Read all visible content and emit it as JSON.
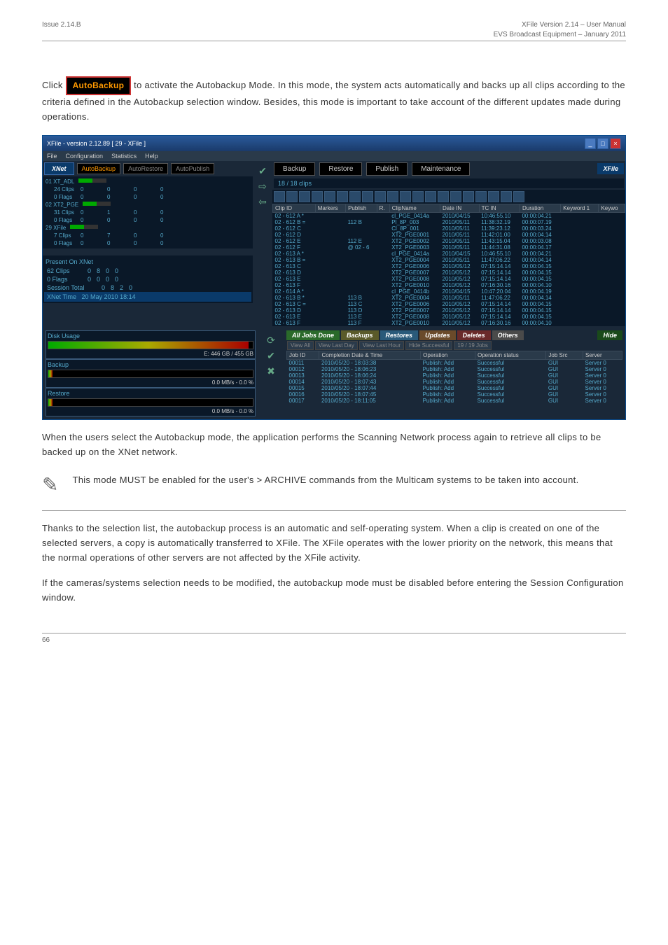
{
  "doc": {
    "issue": "Issue 2.14.B",
    "product": "XFile Version 2.14 – User Manual",
    "company": "EVS Broadcast Equipment – January 2011",
    "page": "66"
  },
  "text": {
    "click": "Click ",
    "autobackup_btn": "AutoBackup",
    "p1": " to activate the Autobackup Mode. In this mode, the system acts automatically and backs up all clips according to the criteria defined in the Autobackup selection window. Besides, this mode is important to take account of the different updates made during operations.",
    "p2": "When the users select the Autobackup mode, the application performs the Scanning Network process again to retrieve all clips to be backed up on the XNet network.",
    "note": "This mode MUST be enabled for the user's > ARCHIVE commands from the Multicam systems to be taken into account.",
    "p3": "Thanks to the selection list, the autobackup process is an automatic and self-operating system. When a clip is created on one of the selected servers, a copy is automatically transferred to XFile. The XFile operates with the lower priority on the network, this means that the normal operations of other servers are not affected by the XFile activity.",
    "p4": "If the cameras/systems selection needs to be modified, the autobackup mode must be disabled before entering the Session Configuration window."
  },
  "app": {
    "title": "XFile - version 2.12.89 [ 29 - XFile ]",
    "menus": [
      "File",
      "Configuration",
      "Statistics",
      "Help"
    ],
    "xnet": "XNet",
    "mode_btns": [
      "AutoBackup",
      "AutoRestore",
      "AutoPublish"
    ],
    "xfile": "XFile",
    "right_btns": [
      "Backup",
      "Restore",
      "Publish",
      "Maintenance"
    ],
    "servers": [
      {
        "hdr": "01 XT_ADL",
        "rows": [
          {
            "l": "24 Clips",
            "a": "0",
            "b": "0",
            "c": "0",
            "d": "0"
          },
          {
            "l": "0 Flags",
            "a": "0",
            "b": "0",
            "c": "0",
            "d": "0"
          }
        ]
      },
      {
        "hdr": "02 XT2_PGE",
        "rows": [
          {
            "l": "31 Clips",
            "a": "0",
            "b": "1",
            "c": "0",
            "d": "0"
          },
          {
            "l": "0 Flags",
            "a": "0",
            "b": "0",
            "c": "0",
            "d": "0"
          }
        ]
      },
      {
        "hdr": "29 XFile",
        "rows": [
          {
            "l": "7 Clips",
            "a": "0",
            "b": "7",
            "c": "0",
            "d": "0"
          },
          {
            "l": "0 Flags",
            "a": "0",
            "b": "0",
            "c": "0",
            "d": "0"
          }
        ]
      }
    ],
    "present": {
      "title": "Present On XNet",
      "rows": [
        {
          "l": "62 Clips",
          "a": "0",
          "b": "8",
          "c": "0",
          "d": "0"
        },
        {
          "l": "0 Flags",
          "a": "0",
          "b": "0",
          "c": "0",
          "d": "0"
        }
      ],
      "session": {
        "l": "Session Total",
        "a": "0",
        "b": "8",
        "c": "2",
        "d": "0"
      },
      "time_label": "XNet Time",
      "time": "20 May 2010   18:14"
    },
    "clip_count": "18 / 18 clips",
    "clips": {
      "cols": [
        "Clip ID",
        "Markers",
        "Publish",
        "R.",
        "ClipName",
        "Date IN",
        "TC IN",
        "Duration",
        "Keyword 1",
        "Keywo"
      ],
      "rows": [
        {
          "id": "02 - 612 A *",
          "pub": "",
          "name": "cl_PGE_0414a",
          "date": "2010/04/15",
          "tc": "10:46:55.10",
          "dur": "00:00:04.21"
        },
        {
          "id": "02 - 612 B =",
          "pub": "112 B",
          "name": "Pl_8P_003",
          "date": "2010/05/11",
          "tc": "11:38:32.19",
          "dur": "00:00:07.19"
        },
        {
          "id": "02 - 612 C",
          "pub": "",
          "name": "Cl_8P_001",
          "date": "2010/05/11",
          "tc": "11:39:23.12",
          "dur": "00:00:03.24"
        },
        {
          "id": "02 - 612 D",
          "pub": "",
          "name": "XT2_PGE0001",
          "date": "2010/05/11",
          "tc": "11:42:01.00",
          "dur": "00:00:04.14"
        },
        {
          "id": "02 - 612 E",
          "pub": "112 E",
          "name": "XT2_PGE0002",
          "date": "2010/05/11",
          "tc": "11:43:15.04",
          "dur": "00:00:03.08"
        },
        {
          "id": "02 - 612 F",
          "pub": "@ 02 - 6",
          "name": "XT2_PGE0003",
          "date": "2010/05/11",
          "tc": "11:44:31.08",
          "dur": "00:00:04.17"
        },
        {
          "id": "02 - 613 A *",
          "pub": "",
          "name": "cl_PGE_0414a",
          "date": "2010/04/15",
          "tc": "10:46:55.10",
          "dur": "00:00:04.21"
        },
        {
          "id": "02 - 613 B =",
          "pub": "",
          "name": "XT2_PGE0004",
          "date": "2010/05/11",
          "tc": "11:47:06.22",
          "dur": "00:00:04.14"
        },
        {
          "id": "02 - 613 C",
          "pub": "",
          "name": "XT2_PGE0006",
          "date": "2010/05/12",
          "tc": "07:15:14.14",
          "dur": "00:00:04.15"
        },
        {
          "id": "02 - 613 D",
          "pub": "",
          "name": "XT2_PGE0007",
          "date": "2010/05/12",
          "tc": "07:15:14.14",
          "dur": "00:00:04.15"
        },
        {
          "id": "02 - 613 E",
          "pub": "",
          "name": "XT2_PGE0008",
          "date": "2010/05/12",
          "tc": "07:15:14.14",
          "dur": "00:00:04.15"
        },
        {
          "id": "02 - 613 F",
          "pub": "",
          "name": "XT2_PGE0010",
          "date": "2010/05/12",
          "tc": "07:16:30.16",
          "dur": "00:00:04.10"
        },
        {
          "id": "02 - 614 A *",
          "pub": "",
          "name": "cl_PGE_0414b",
          "date": "2010/04/15",
          "tc": "10:47:20.04",
          "dur": "00:00:04.19"
        },
        {
          "id": "02 - 613 B *",
          "pub": "113 B",
          "name": "XT2_PGE0004",
          "date": "2010/05/11",
          "tc": "11:47:06.22",
          "dur": "00:00:04.14"
        },
        {
          "id": "02 - 613 C =",
          "pub": "113 C",
          "name": "XT2_PGE0006",
          "date": "2010/05/12",
          "tc": "07:15:14.14",
          "dur": "00:00:04.15"
        },
        {
          "id": "02 - 613 D",
          "pub": "113 D",
          "name": "XT2_PGE0007",
          "date": "2010/05/12",
          "tc": "07:15:14.14",
          "dur": "00:00:04.15"
        },
        {
          "id": "02 - 613 E",
          "pub": "113 E",
          "name": "XT2_PGE0008",
          "date": "2010/05/12",
          "tc": "07:15:14.14",
          "dur": "00:00:04.15"
        },
        {
          "id": "02 - 613 F",
          "pub": "113 F",
          "name": "XT2_PGE0010",
          "date": "2010/05/12",
          "tc": "07:16:30.16",
          "dur": "00:00:04.10"
        }
      ]
    },
    "disk": {
      "usage_label": "Disk Usage",
      "e_label": "E: 446 GB / 455 GB",
      "backup_label": "Backup",
      "backup_rate": "0.0 MB/s - 0.0 %",
      "restore_label": "Restore",
      "restore_rate": "0.0 MB/s - 0.0 %"
    },
    "jobs": {
      "tabs": [
        "All Jobs Done",
        "Backups",
        "Restores",
        "Updates",
        "Deletes",
        "Others"
      ],
      "hide": "Hide",
      "filters": [
        "View All",
        "View Last Day",
        "View Last Hour",
        "Hide Successful",
        "19 / 19 Jobs"
      ],
      "cols": [
        "Job ID",
        "Completion Date & Time",
        "Operation",
        "Operation status",
        "Job Src",
        "Server"
      ],
      "rows": [
        {
          "id": "00011",
          "dt": "2010/05/20 - 18:03:38",
          "op": "Publish: Add",
          "st": "Successful",
          "src": "GUI",
          "srv": "Server 0"
        },
        {
          "id": "00012",
          "dt": "2010/05/20 - 18:06:23",
          "op": "Publish: Add",
          "st": "Successful",
          "src": "GUI",
          "srv": "Server 0"
        },
        {
          "id": "00013",
          "dt": "2010/05/20 - 18:06:24",
          "op": "Publish: Add",
          "st": "Successful",
          "src": "GUI",
          "srv": "Server 0"
        },
        {
          "id": "00014",
          "dt": "2010/05/20 - 18:07:43",
          "op": "Publish: Add",
          "st": "Successful",
          "src": "GUI",
          "srv": "Server 0"
        },
        {
          "id": "00015",
          "dt": "2010/05/20 - 18:07:44",
          "op": "Publish: Add",
          "st": "Successful",
          "src": "GUI",
          "srv": "Server 0"
        },
        {
          "id": "00016",
          "dt": "2010/05/20 - 18:07:45",
          "op": "Publish: Add",
          "st": "Successful",
          "src": "GUI",
          "srv": "Server 0"
        },
        {
          "id": "00017",
          "dt": "2010/05/20 - 18:11:05",
          "op": "Publish: Add",
          "st": "Successful",
          "src": "GUI",
          "srv": "Server 0"
        }
      ]
    }
  }
}
